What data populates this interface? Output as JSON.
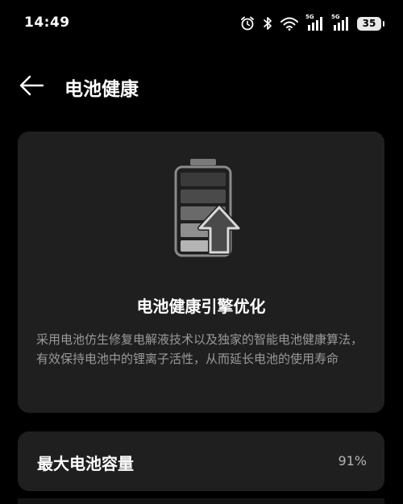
{
  "status_bar": {
    "time": "14:49",
    "battery_level": "35",
    "network_label": "5G",
    "icons": [
      "alarm-icon",
      "bluetooth-icon",
      "wifi-icon",
      "signal-5g-icon",
      "signal-5g-icon",
      "battery-icon"
    ]
  },
  "header": {
    "back_icon": "back-arrow-icon",
    "title": "电池健康"
  },
  "hero": {
    "illustration_icon": "battery-upgrade-icon",
    "title": "电池健康引擎优化",
    "description": "采用电池仿生修复电解液技术以及独家的智能电池健康算法，有效保持电池中的锂离子活性，从而延长电池的使用寿命"
  },
  "capacity": {
    "label": "最大电池容量",
    "value": "91%"
  },
  "colors": {
    "background": "#000000",
    "card": "#1f1f1f",
    "text_primary": "#ffffff",
    "text_secondary": "#9a9a9a"
  }
}
